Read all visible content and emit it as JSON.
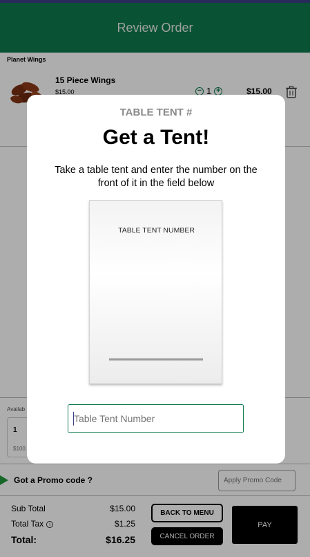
{
  "header": {
    "title": "Review Order"
  },
  "order": {
    "vendor": "Planet Wings",
    "items": [
      {
        "name": "15 Piece Wings",
        "price": "$15.00",
        "quantity": "1",
        "total": "$15.00"
      }
    ]
  },
  "available": {
    "label": "Availab",
    "card_number": "1",
    "card_price": "$100"
  },
  "promo": {
    "label": "Got a Promo code ?",
    "placeholder": "Apply Promo Code"
  },
  "totals": {
    "subtotal_label": "Sub Total",
    "subtotal_value": "$15.00",
    "tax_label": "Total Tax",
    "tax_value": "$1.25",
    "total_label": "Total:",
    "total_value": "$16.25"
  },
  "actions": {
    "back_label": "BACK TO MENU",
    "cancel_label": "CANCEL ORDER",
    "pay_label": "PAY"
  },
  "modal": {
    "eyebrow": "TABLE TENT #",
    "title": "Get a Tent!",
    "description": "Take a table tent and enter the number on the front of it in the field below",
    "tent_card_label": "TABLE TENT NUMBER",
    "input_placeholder": "Table Tent Number"
  },
  "colors": {
    "brand_green": "#0f7a4d",
    "promo_arrow": "#1f9a3a"
  },
  "icons": {
    "trash": "trash-icon",
    "info": "info-icon",
    "minus": "minus-circle-icon",
    "plus": "plus-circle-icon"
  }
}
